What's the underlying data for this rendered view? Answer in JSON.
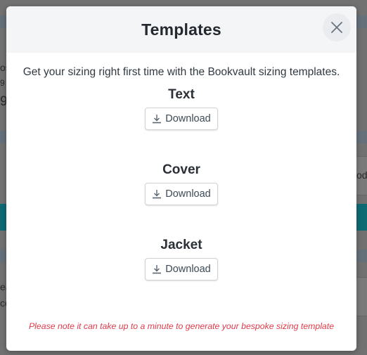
{
  "modal": {
    "title": "Templates",
    "intro": "Get your sizing right first time with the Bookvault sizing templates.",
    "sections": [
      {
        "title": "Text",
        "button_label": "Download"
      },
      {
        "title": "Cover",
        "button_label": "Download"
      },
      {
        "title": "Jacket",
        "button_label": "Download"
      }
    ],
    "note": "Please note it can take up to a minute to generate your bespoke sizing template",
    "icons": {
      "close": "close-icon",
      "download": "download-icon"
    }
  },
  "background": {
    "fragments": [
      "os",
      "9",
      "9",
      "od",
      "ea",
      "co"
    ]
  },
  "colors": {
    "note": "#e03a4a",
    "header_bg": "#f4f5f7",
    "backdrop": "#717171",
    "teal_band": "#0e6b73"
  }
}
